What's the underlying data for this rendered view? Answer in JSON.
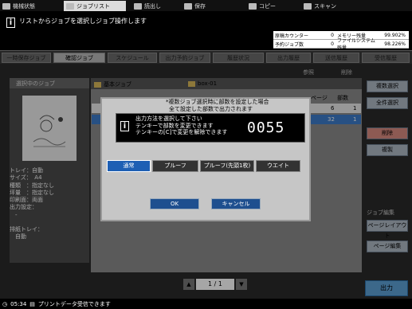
{
  "top_tabs": [
    {
      "label": "機械状態",
      "icon": "machine-icon"
    },
    {
      "label": "ジョブリスト",
      "icon": "joblist-icon"
    },
    {
      "label": "読出し",
      "icon": "read-icon"
    },
    {
      "label": "保存",
      "icon": "save-icon"
    },
    {
      "label": "コピー",
      "icon": "copy-icon"
    },
    {
      "label": "スキャン",
      "icon": "scan-icon"
    }
  ],
  "message": "リストからジョブを選択しジョブ操作します",
  "counters": [
    {
      "label": "原稿カウンター",
      "value": "0",
      "label2": "メモリー残量",
      "value2": "99.902%"
    },
    {
      "label": "予約ジョブ数",
      "value": "0",
      "label2": "ファイルシステム残量",
      "value2": "98.226%"
    }
  ],
  "sub_tabs": [
    "一時保存ジョブ",
    "確認ジョブ",
    "スケジュール",
    "出力予約ジョブ",
    "履歴状況",
    "出力履歴",
    "送信履歴",
    "受信履歴"
  ],
  "left_panel": {
    "header": "選択中のジョブ",
    "details": [
      "トレイ：自動",
      "サイズ：　A4",
      "種類　：指定なし",
      "坪量　：指定なし",
      "印刷面：両面",
      "出力設定：",
      "　-",
      "",
      "排紙トレイ：",
      "　自動"
    ]
  },
  "list": {
    "folders": [
      "基本ジョブ",
      "box-01"
    ],
    "col_page": "ページ",
    "col_copies": "部数",
    "rows": [
      {
        "page": "6",
        "copies": "1"
      },
      {
        "page": "32",
        "copies": "1"
      }
    ],
    "btn_browse": "参照",
    "btn_delete": "削除"
  },
  "right_buttons": {
    "multi_select": "複数選択",
    "select_all": "全件選択",
    "delete": "削除",
    "copy_doc": "複製",
    "group_label": "ジョブ編集",
    "layout": "ページレイアウト",
    "page_edit": "ページ編集",
    "output": "出力"
  },
  "pager": {
    "current": "1",
    "total": "/ 1"
  },
  "status": {
    "time": "05:34",
    "text": "プリントデータ受信できます"
  },
  "dialog": {
    "note_line1": "*複数ジョブ選択時に部数を設定した場合",
    "note_line2": "全て設定した部数で出力されます",
    "msg_line1": "出力方法を選択して下さい",
    "msg_line2": "テンキーで部数を変更できます",
    "msg_line3": "テンキーの[C]で変更を解除できます",
    "count": "0055",
    "modes": [
      "通常",
      "プルーフ",
      "プルーフ(先頭1枚)",
      "ウエイト"
    ],
    "ok": "OK",
    "cancel": "キャンセル"
  }
}
